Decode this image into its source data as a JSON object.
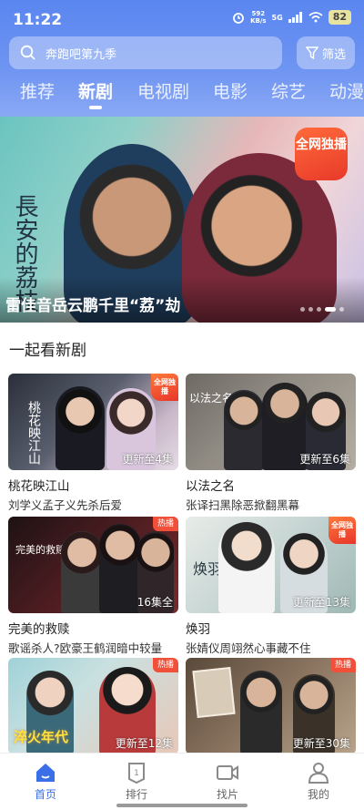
{
  "status_bar": {
    "time": "11:22",
    "net_speed": "592",
    "net_unit": "KB/s",
    "signal": "5G",
    "battery": "82"
  },
  "search": {
    "placeholder": "奔跑吧第九季",
    "filter_label": "筛选"
  },
  "tabs": [
    "推荐",
    "新剧",
    "电视剧",
    "电影",
    "综艺",
    "动漫"
  ],
  "active_tab": "新剧",
  "banner": {
    "title": "雷佳音岳云鹏千里“荔”劫",
    "calligraphy": "長安的荔枝",
    "badge": "全网独播",
    "page_count": 5,
    "active_page": 4
  },
  "section": {
    "title": "一起看新剧"
  },
  "cards": [
    {
      "title": "桃花映江山",
      "subtitle": "刘学义孟子义先杀后爱",
      "status": "更新至4集",
      "badge": "全网独播",
      "art_text": "桃花映江山"
    },
    {
      "title": "以法之名",
      "subtitle": "张译扫黑除恶掀翻黑幕",
      "status": "更新至6集",
      "badge": "",
      "art_text": "以法之名"
    },
    {
      "title": "完美的救赎",
      "subtitle": "歌谣杀人?欧豪王鹤润暗中较量",
      "status": "16集全",
      "badge": "热播",
      "art_text": "完美的救赎"
    },
    {
      "title": "焕羽",
      "subtitle": "张婧仪周翊然心事藏不住",
      "status": "更新至13集",
      "badge": "全网独播",
      "art_text": "焕羽"
    },
    {
      "title": "",
      "subtitle": "",
      "status": "更新至12集",
      "badge": "热播",
      "art_text": "淬火年代"
    },
    {
      "title": "",
      "subtitle": "",
      "status": "更新至30集",
      "badge": "热播",
      "art_text": ""
    }
  ],
  "bottom_nav": [
    {
      "label": "首页",
      "icon": "home-icon",
      "active": true
    },
    {
      "label": "排行",
      "icon": "ranking-icon",
      "active": false
    },
    {
      "label": "找片",
      "icon": "video-camera-icon",
      "active": false
    },
    {
      "label": "我的",
      "icon": "user-icon",
      "active": false
    }
  ],
  "colors": {
    "header_blue": "#5a86f0",
    "accent": "#3a6fe8",
    "badge_red": "#e8352a"
  }
}
